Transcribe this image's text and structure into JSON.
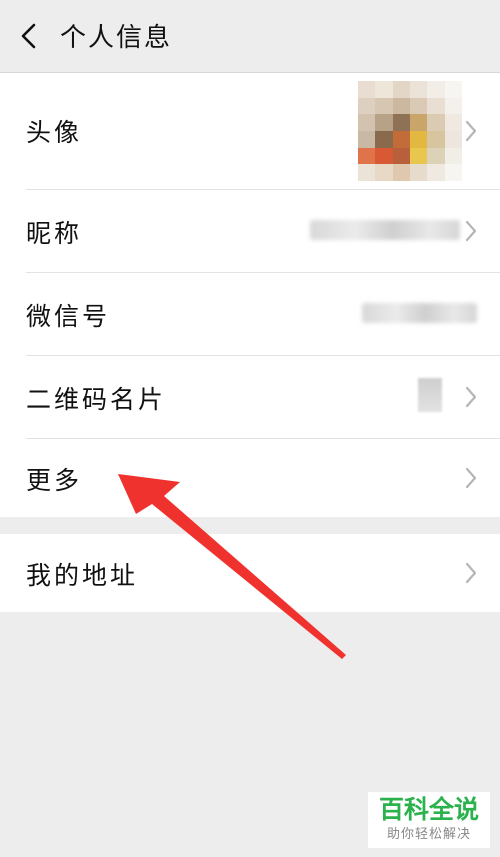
{
  "header": {
    "title": "个人信息",
    "back_icon": "chevron-left-icon"
  },
  "rows": {
    "avatar_label": "头像",
    "nickname_label": "昵称",
    "wechat_id_label": "微信号",
    "qr_card_label": "二维码名片",
    "more_label": "更多",
    "address_label": "我的地址"
  },
  "watermark": {
    "title": "百科全说",
    "subtitle": "助你轻松解决"
  },
  "colors": {
    "background": "#ededed",
    "card": "#ffffff",
    "arrow": "#f0322e",
    "watermark_green": "#2bb24c"
  }
}
